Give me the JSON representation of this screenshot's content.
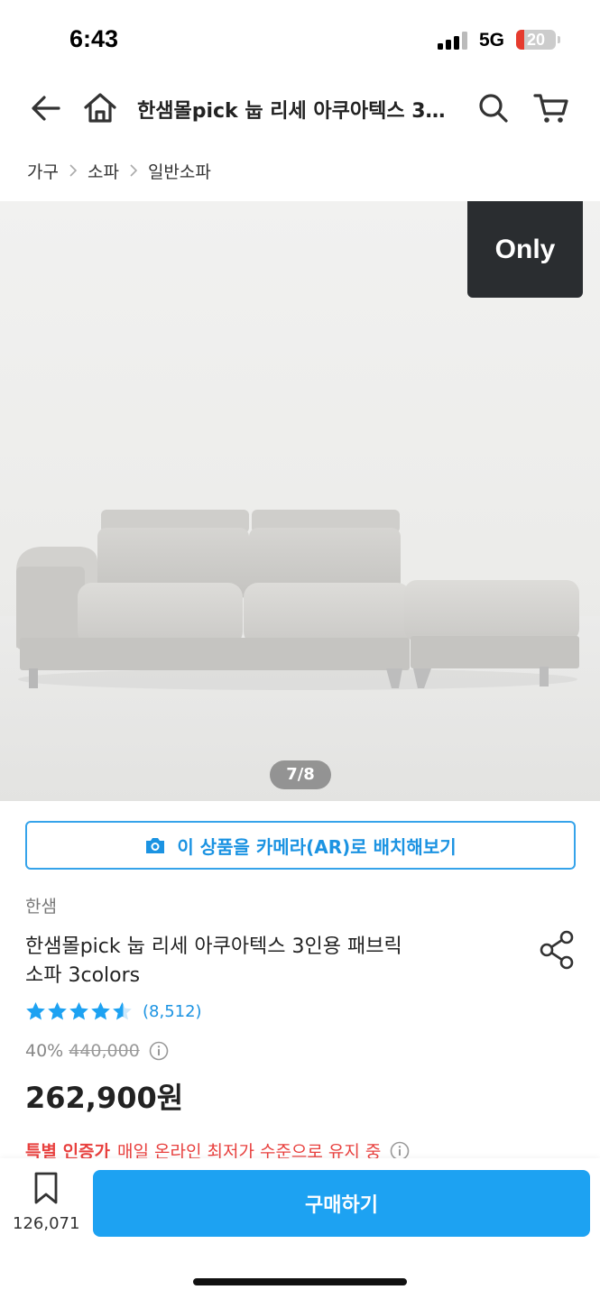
{
  "status_bar": {
    "time": "6:43",
    "network": "5G",
    "battery": "20",
    "battery_level_percent": 20,
    "battery_color": "#e63b2e"
  },
  "nav": {
    "title": "한샘몰pick 눕 리세 아쿠아텍스 3인용 패브릭 소파 3colors",
    "back_icon": "back-arrow-icon",
    "home_icon": "home-icon",
    "search_icon": "search-icon",
    "cart_icon": "cart-icon"
  },
  "breadcrumb": [
    "가구",
    "소파",
    "일반소파"
  ],
  "hero": {
    "badge": "Only",
    "page_indicator": "7/8"
  },
  "ar_button": {
    "label": "이 상품을 카메라(AR)로 배치해보기",
    "icon": "camera-icon"
  },
  "product": {
    "brand": "한샘",
    "title_line1": "한샘몰pick 눕 리세 아쿠아텍스 3인용 패브릭",
    "title_line2": "소파 3colors",
    "rating_stars": 4.5,
    "review_count": "(8,512)",
    "discount": "40%",
    "original_price": "440,000",
    "price": "262,900원"
  },
  "certification": {
    "label": "특별 인증가",
    "text": "매일 온라인 최저가 수준으로 유지 중"
  },
  "bottom_bar": {
    "bookmark_count": "126,071",
    "buy_label": "구매하기"
  },
  "colors": {
    "accent": "#1da2f2",
    "link": "#1b93e2",
    "highlight_red": "#e8413f",
    "badge_bg": "#2a2d30"
  }
}
